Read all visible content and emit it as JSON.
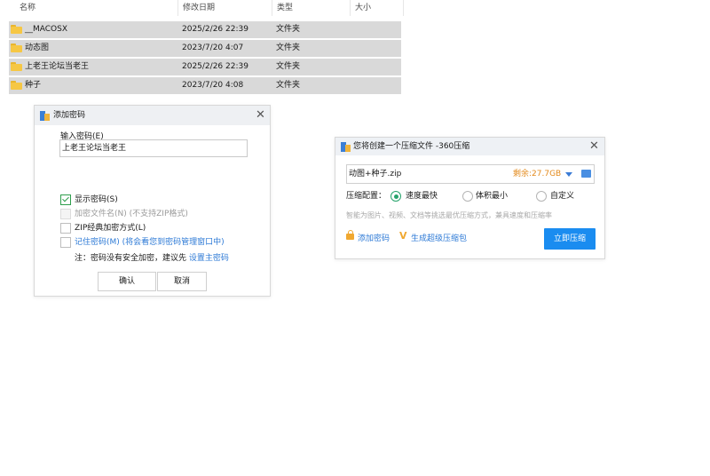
{
  "file_list": {
    "columns": {
      "name": "名称",
      "modified": "修改日期",
      "type": "类型",
      "size": "大小"
    },
    "rows": [
      {
        "name": "__MACOSX",
        "modified": "2025/2/26 22:39",
        "type": "文件夹"
      },
      {
        "name": "动态图",
        "modified": "2023/7/20 4:07",
        "type": "文件夹"
      },
      {
        "name": "上老王论坛当老王",
        "modified": "2025/2/26 22:39",
        "type": "文件夹"
      },
      {
        "name": "种子",
        "modified": "2023/7/20 4:08",
        "type": "文件夹"
      }
    ]
  },
  "password_dialog": {
    "title": "添加密码",
    "input_label": "输入密码(E)",
    "password_value": "上老王论坛当老王",
    "options": {
      "show_password": "显示密码(S)",
      "encrypt_filename": "加密文件名(N) (不支持ZIP格式)",
      "zip_classic": "ZIP经典加密方式(L)",
      "remember_password": "记住密码(M) (将会看您到密码管理窗口中)"
    },
    "note_prefix": "注：密码没有安全加密，建议先 ",
    "note_link": "设置主密码",
    "ok_label": "确认",
    "cancel_label": "取消"
  },
  "compress_dialog": {
    "title": "您将创建一个压缩文件 -360压缩",
    "filename": "动图+种子.zip",
    "free_space": "剩余:27.7GB",
    "config_label": "压缩配置：",
    "radio_options": [
      "速度最快",
      "体积最小",
      "自定义"
    ],
    "hint": "智能为图片、视频、文档等挑选最优压缩方式，兼具速度和压缩率",
    "add_password": "添加密码",
    "create_sfx": "生成超级压缩包",
    "compress_now": "立即压缩"
  },
  "colors": {
    "accent_blue": "#1a8cf0",
    "accent_green": "#27a36c",
    "accent_orange": "#e38a1c",
    "link": "#2d7ad6"
  }
}
